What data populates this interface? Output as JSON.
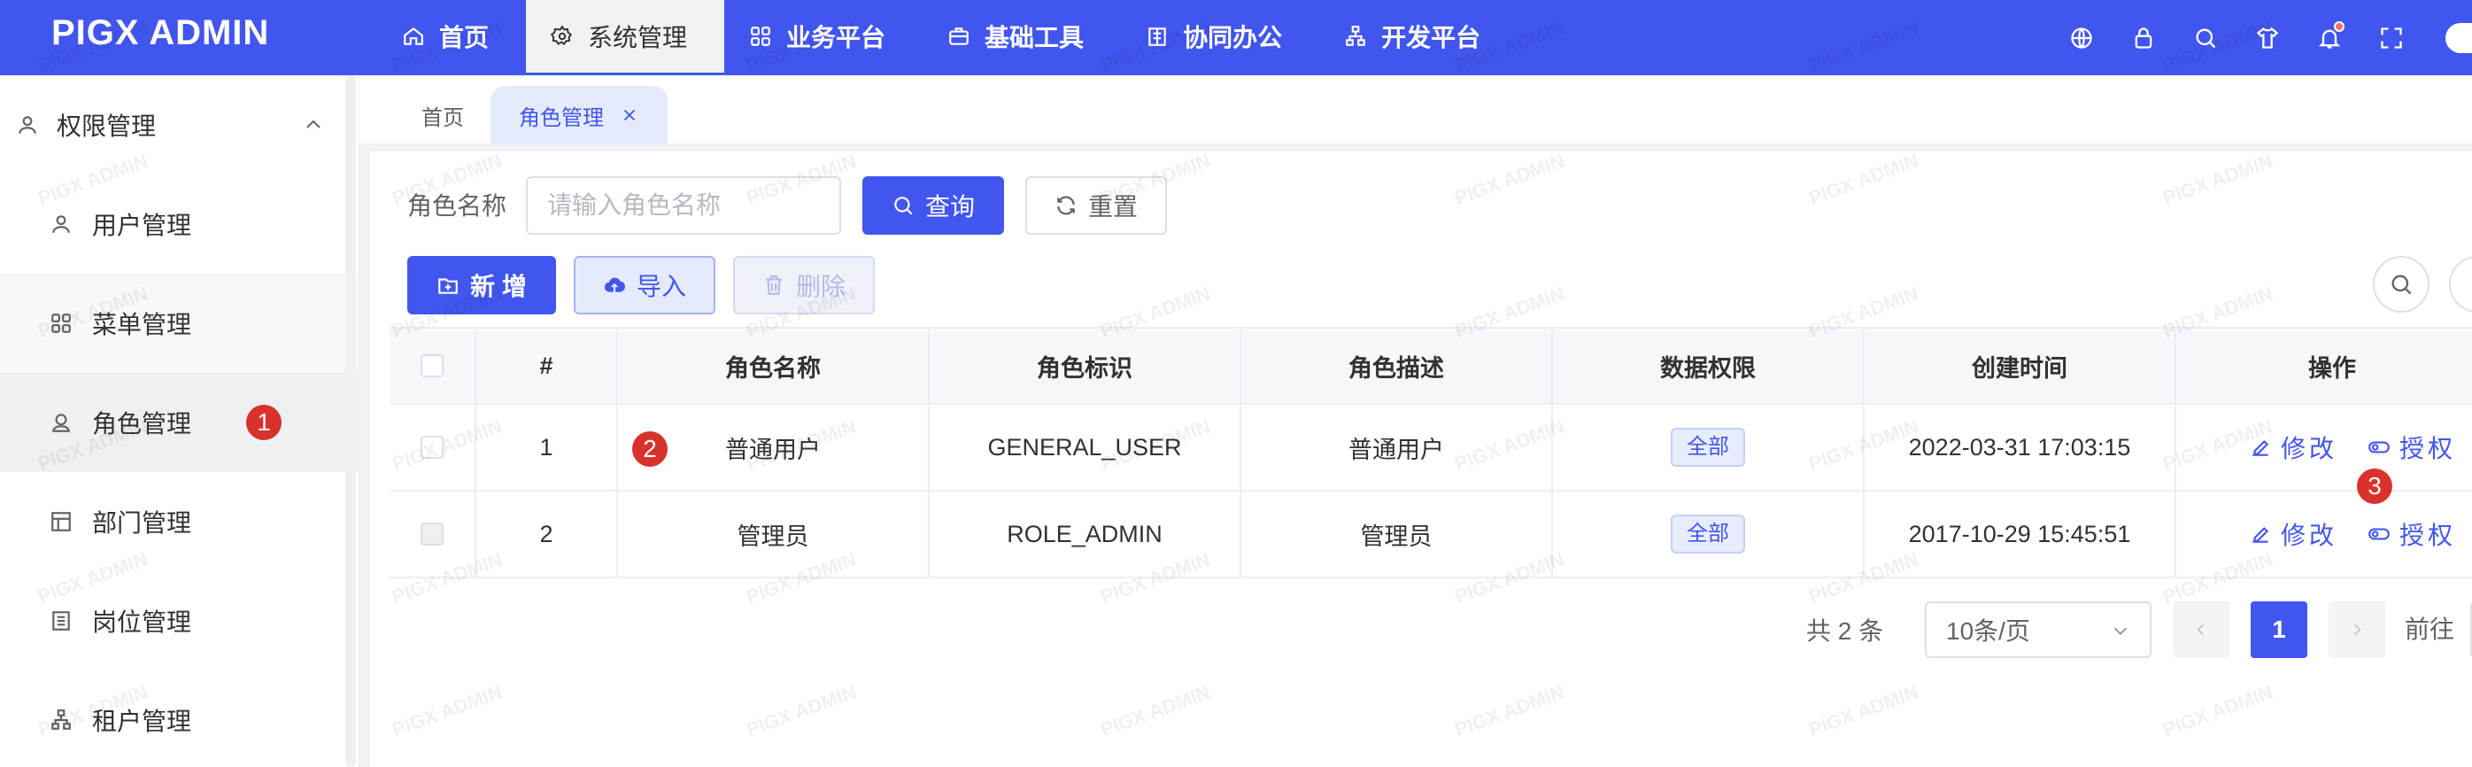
{
  "app": {
    "logo": "PIGX ADMIN",
    "watermark": "PIGX ADMIN"
  },
  "topnav": [
    {
      "label": "首页",
      "icon": "home-icon"
    },
    {
      "label": "系统管理",
      "icon": "gear-icon",
      "active": true
    },
    {
      "label": "业务平台",
      "icon": "grid-icon"
    },
    {
      "label": "基础工具",
      "icon": "briefcase-icon"
    },
    {
      "label": "协同办公",
      "icon": "building-icon"
    },
    {
      "label": "开发平台",
      "icon": "sitemap-icon"
    }
  ],
  "header_icons": [
    "globe-icon",
    "lock-icon",
    "search-icon",
    "shirt-icon",
    "bell-icon",
    "fullscreen-icon"
  ],
  "sidebar": {
    "group": "权限管理",
    "items": [
      {
        "label": "用户管理",
        "icon": "user-icon"
      },
      {
        "label": "菜单管理",
        "icon": "grid-icon"
      },
      {
        "label": "角色管理",
        "icon": "role-icon",
        "active": true
      },
      {
        "label": "部门管理",
        "icon": "department-icon"
      },
      {
        "label": "岗位管理",
        "icon": "list-icon"
      },
      {
        "label": "租户管理",
        "icon": "tenant-icon"
      }
    ]
  },
  "tabs": {
    "home": "首页",
    "current": "角色管理"
  },
  "search": {
    "label": "角色名称",
    "placeholder": "请输入角色名称",
    "query": "查询",
    "reset": "重置"
  },
  "toolbar": {
    "add": "新 增",
    "import": "导入",
    "delete": "删除"
  },
  "table": {
    "columns": [
      "#",
      "角色名称",
      "角色标识",
      "角色描述",
      "数据权限",
      "创建时间",
      "操作"
    ],
    "rows": [
      {
        "index": "1",
        "name": "普通用户",
        "code": "GENERAL_USER",
        "desc": "普通用户",
        "scope": "全部",
        "created": "2022-03-31 17:03:15"
      },
      {
        "index": "2",
        "name": "管理员",
        "code": "ROLE_ADMIN",
        "desc": "管理员",
        "scope": "全部",
        "created": "2017-10-29 15:45:51"
      }
    ],
    "actions": {
      "edit": "修改",
      "auth": "授权"
    }
  },
  "pagination": {
    "total": "共 2 条",
    "page_size": "10条/页",
    "current": "1",
    "goto": "前往"
  },
  "markers": [
    "1",
    "2",
    "3"
  ],
  "colors": {
    "primary": "#4156ee",
    "marker": "#d8322c"
  }
}
